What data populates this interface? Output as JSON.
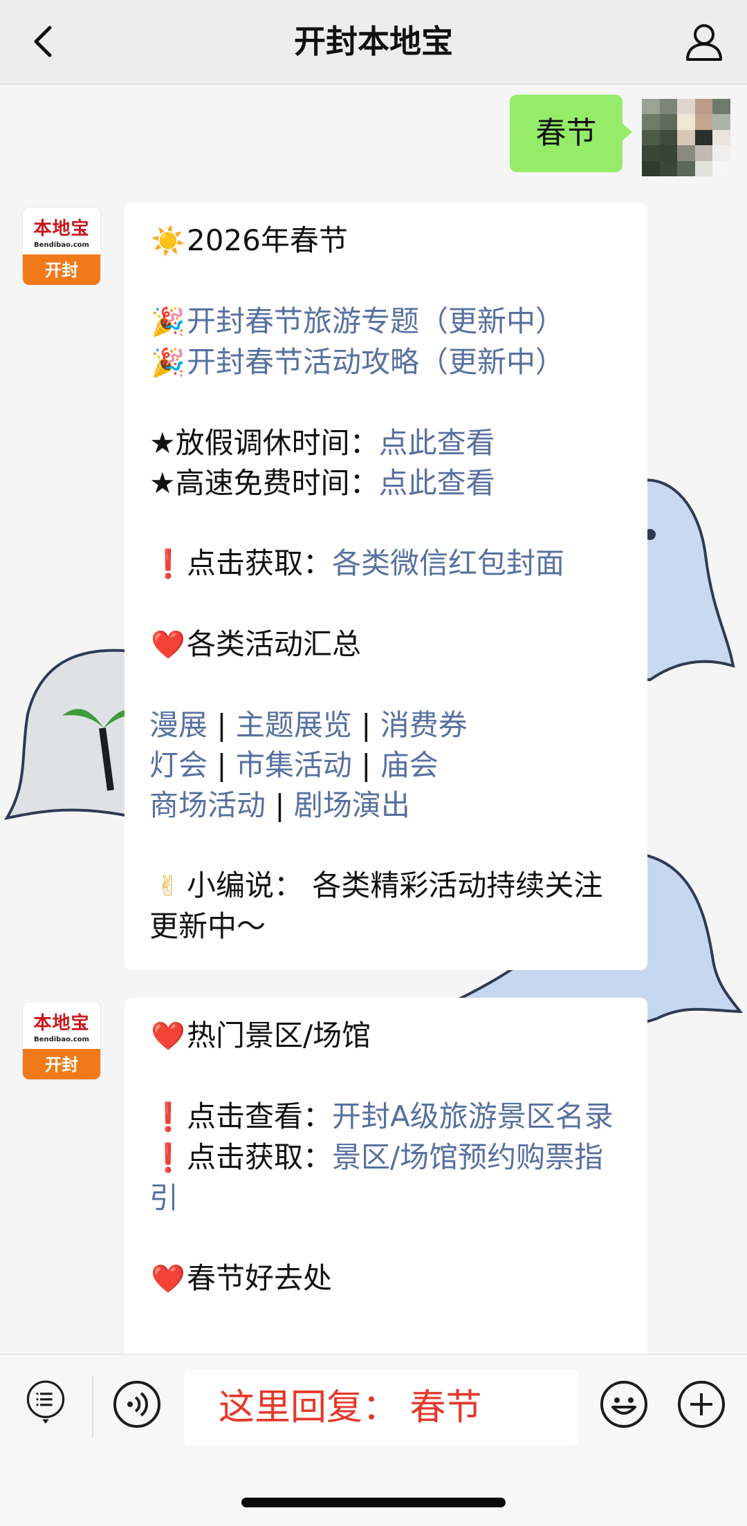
{
  "header": {
    "title": "开封本地宝"
  },
  "outgoing": {
    "text": "春节"
  },
  "official_avatar": {
    "brand": "本地宝",
    "domain": "Bendibao.com",
    "city": "开封"
  },
  "message1": {
    "sun_icon": "☀️",
    "title": "2026年春节",
    "party_icon": "🎉",
    "link1": "开封春节旅游专题（更新中）",
    "link2": "开封春节活动攻略（更新中）",
    "star_icon": "★",
    "holiday_label": "放假调休时间：",
    "holiday_link": "点此查看",
    "highway_label": "高速免费时间：",
    "highway_link": "点此查看",
    "exclaim_icon": "❗",
    "redpacket_label": "点击获取：",
    "redpacket_link": "各类微信红包封面",
    "heart_icon": "❤️",
    "activities_title": "各类活动汇总",
    "sep": "|",
    "tag1": "漫展",
    "tag2": "主题展览",
    "tag3": "消费券",
    "tag4": "灯会",
    "tag5": "市集活动",
    "tag6": "庙会",
    "tag7": "商场活动",
    "tag8": "剧场演出",
    "victory_icon": "✌",
    "editor_note": "小编说： 各类精彩活动持续关注更新中～"
  },
  "message2": {
    "heart_icon": "❤️",
    "title": "热门景区/场馆",
    "exclaim_icon": "❗",
    "view_label": "点击查看：",
    "view_link": "开封A级旅游景区名录",
    "get_label": "点击获取：",
    "get_link": "景区/场馆预约购票指引",
    "good_places": "春节好去处"
  },
  "bottombar": {
    "reply_hint": "这里回复：  春节"
  },
  "colors": {
    "link": "#57709f",
    "outgoing_bubble": "#95ec69",
    "reply_hint": "#e4392b",
    "badge": "#f07a1a"
  }
}
